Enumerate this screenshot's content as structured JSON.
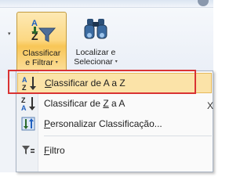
{
  "ribbon": {
    "group_dropdown_arrow": "▾",
    "sort_filter_button": {
      "line1": "Classificar",
      "line2": "e Filtrar",
      "caret": "▾",
      "icon": "sort-filter-icon"
    },
    "find_select_button": {
      "line1": "Localizar e",
      "line2": "Selecionar",
      "caret": "▾",
      "icon": "binoculars-icon"
    }
  },
  "menu": {
    "items": [
      {
        "pre": "",
        "accel": "C",
        "post": "lassificar de A a Z",
        "icon": "sort-ascending-icon"
      },
      {
        "pre": "Classificar de ",
        "accel": "Z",
        "post": " a A",
        "icon": "sort-descending-icon"
      },
      {
        "pre": "",
        "accel": "P",
        "post": "ersonalizar Classificação...",
        "icon": "custom-sort-icon"
      },
      {
        "pre": "",
        "accel": "F",
        "post": "iltro",
        "icon": "filter-icon"
      }
    ]
  },
  "cut_off_text": "X",
  "colors": {
    "hover_fill": "#fbe3a8",
    "hover_border": "#e5b85a",
    "highlight_box": "#d93333",
    "sort_red": "#c0392b",
    "sort_blue": "#1f5fbf"
  }
}
